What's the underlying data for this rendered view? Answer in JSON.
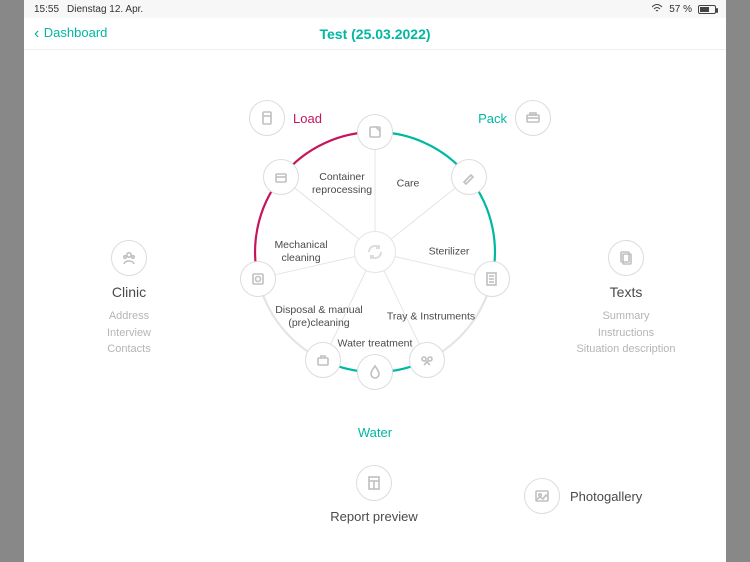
{
  "statusbar": {
    "time": "15:55",
    "date": "Dienstag 12. Apr.",
    "battery_pct": "57 %",
    "wifi_icon": "wifi"
  },
  "nav": {
    "back_label": "Dashboard",
    "title": "Test (25.03.2022)"
  },
  "top": {
    "load_label": "Load",
    "pack_label": "Pack"
  },
  "left_panel": {
    "title": "Clinic",
    "items": [
      "Address",
      "Interview",
      "Contacts"
    ]
  },
  "right_panel": {
    "title": "Texts",
    "items": [
      "Summary",
      "Instructions",
      "Situation description"
    ]
  },
  "wheel": {
    "segments": [
      {
        "id": "container-reprocessing",
        "label": "Container reprocessing"
      },
      {
        "id": "care",
        "label": "Care"
      },
      {
        "id": "sterilizer",
        "label": "Sterilizer"
      },
      {
        "id": "tray-instruments",
        "label": "Tray & Instruments"
      },
      {
        "id": "water-treatment",
        "label": "Water treatment"
      },
      {
        "id": "disposal-manual",
        "label": "Disposal & manual (pre)cleaning"
      },
      {
        "id": "mechanical-cleaning",
        "label": "Mechanical cleaning"
      }
    ],
    "colors": {
      "load_arc": "#c6155b",
      "pack_arc": "#00b8a0",
      "water_arc": "#00b8a0"
    }
  },
  "bottom": {
    "water_label": "Water",
    "report_label": "Report preview",
    "gallery_label": "Photogallery"
  }
}
